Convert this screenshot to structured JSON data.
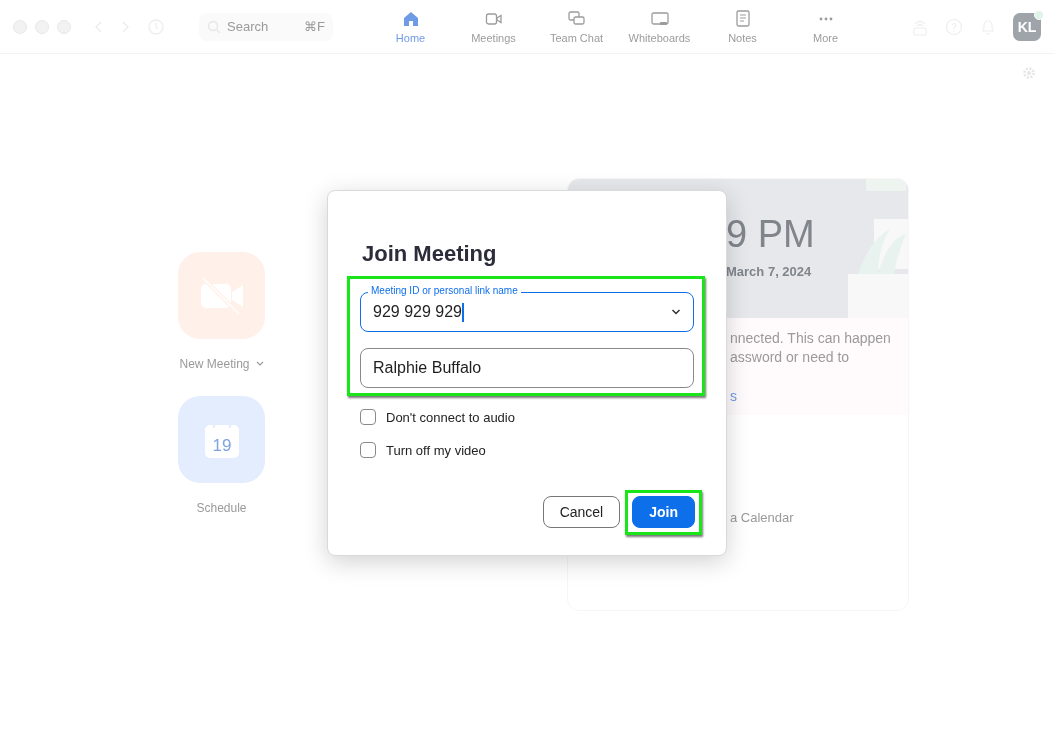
{
  "topbar": {
    "search": {
      "placeholder": "Search",
      "shortcut": "⌘F"
    },
    "tabs": [
      {
        "label": "Home",
        "kind": "home",
        "selected": true
      },
      {
        "label": "Meetings",
        "kind": "video",
        "selected": false
      },
      {
        "label": "Team Chat",
        "kind": "chat",
        "selected": false
      },
      {
        "label": "Whiteboards",
        "kind": "whiteboard",
        "selected": false
      },
      {
        "label": "Notes",
        "kind": "notes",
        "selected": false
      },
      {
        "label": "More",
        "kind": "more",
        "selected": false
      }
    ],
    "avatar": {
      "initials": "KL",
      "online": true
    }
  },
  "home": {
    "actions": [
      {
        "label": "New Meeting",
        "kind": "video-off",
        "dropdown": true
      },
      {
        "label": "Schedule",
        "kind": "calendar",
        "day": "19",
        "dropdown": false
      }
    ]
  },
  "card": {
    "time": "9 PM",
    "date": "March 7, 2024",
    "message_lines": [
      "nnected. This can happen",
      "assword or need to"
    ],
    "link": "s",
    "calendar_text": "a Calendar"
  },
  "dialog": {
    "title": "Join Meeting",
    "fields_highlighted": true,
    "meeting_id": {
      "label": "Meeting ID or personal link name",
      "value": "929 929 929",
      "focused": true
    },
    "name": {
      "value": "Ralphie Buffalo",
      "focused": false
    },
    "options": [
      {
        "label": "Don't connect to audio",
        "checked": false
      },
      {
        "label": "Turn off my video",
        "checked": false
      }
    ],
    "buttons": [
      {
        "label": "Cancel",
        "kind": "secondary",
        "highlighted": false
      },
      {
        "label": "Join",
        "kind": "primary",
        "highlighted": true
      }
    ]
  }
}
